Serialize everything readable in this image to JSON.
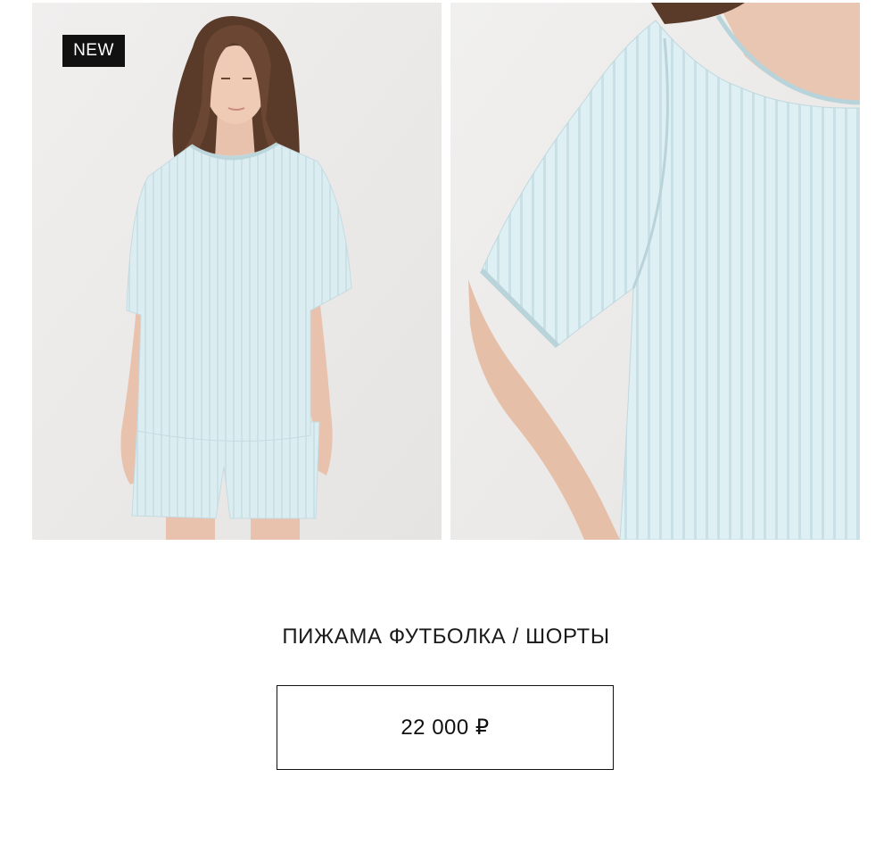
{
  "product": {
    "badge": "NEW",
    "title": "ПИЖАМА ФУТБОЛКА / ШОРТЫ",
    "price": "22 000 ₽"
  },
  "colors": {
    "garment": "#dbeef2",
    "background": "#ecebea",
    "badge_bg": "#111111",
    "text": "#111111"
  }
}
